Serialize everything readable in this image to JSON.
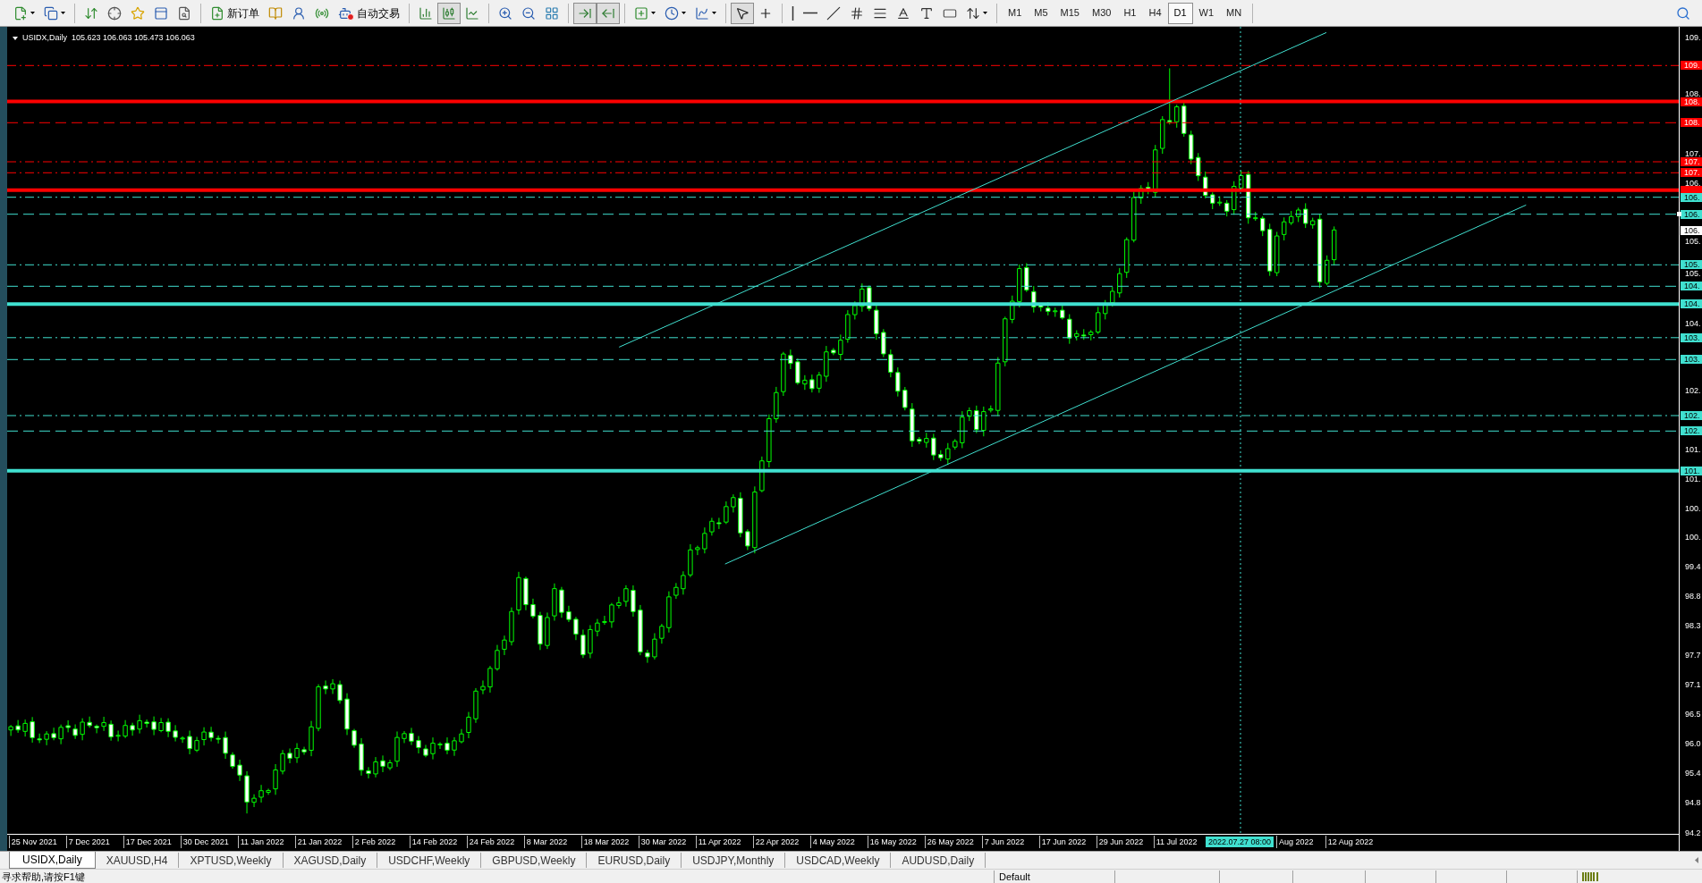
{
  "toolbar": {
    "order_button": "新订单",
    "autotrading": {
      "label": "自动交易",
      "enabled": false
    },
    "chart_types": [
      {
        "selected": false
      },
      {
        "selected": true
      },
      {
        "selected": false
      }
    ],
    "chart_toggles": [
      {
        "selected": true
      },
      {
        "selected": true
      }
    ],
    "cursor_tools": [
      {
        "selected": true
      },
      {
        "selected": false
      }
    ],
    "timeframes": [
      {
        "label": "M1",
        "selected": false
      },
      {
        "label": "M5",
        "selected": false
      },
      {
        "label": "M15",
        "selected": false
      },
      {
        "label": "M30",
        "selected": false
      },
      {
        "label": "H1",
        "selected": false
      },
      {
        "label": "H4",
        "selected": false
      },
      {
        "label": "D1",
        "selected": true
      },
      {
        "label": "W1",
        "selected": false
      },
      {
        "label": "MN",
        "selected": false
      }
    ]
  },
  "chart": {
    "symbol": "USIDX,Daily",
    "ohlc": "105.623 106.063 105.473 106.063",
    "price_ticks": [
      "109.",
      "108.",
      "107.",
      "106.",
      "105.",
      "105.",
      "104.",
      "102.",
      "101.",
      "101.",
      "100.",
      "100.",
      "99.4",
      "98.8",
      "98.3",
      "97.7",
      "97.1",
      "96.5",
      "96.0",
      "95.4",
      "94.8",
      "94.2"
    ],
    "current_price": "106.",
    "levels": [
      {
        "kind": "dashdot",
        "color": "#ff0000",
        "label": "109."
      },
      {
        "kind": "solid",
        "color": "#ff0000",
        "label": "108."
      },
      {
        "kind": "dash",
        "color": "#ff0000",
        "label": "108."
      },
      {
        "kind": "dashdot",
        "color": "#ff0000",
        "label": "107."
      },
      {
        "kind": "dashdot",
        "color": "#ff0000",
        "label": "107."
      },
      {
        "kind": "solid",
        "color": "#ff0000"
      },
      {
        "kind": "dashdot",
        "color": "#40e0d0",
        "label": "106."
      },
      {
        "kind": "dash",
        "color": "#40e0d0",
        "label": "106."
      },
      {
        "kind": "dashdot",
        "color": "#40e0d0",
        "label": "105."
      },
      {
        "kind": "dash",
        "color": "#40e0d0",
        "label": "104."
      },
      {
        "kind": "solid",
        "color": "#40e0d0",
        "label": "104."
      },
      {
        "kind": "dashdot",
        "color": "#40e0d0",
        "label": "103."
      },
      {
        "kind": "dash",
        "color": "#40e0d0",
        "label": "103."
      },
      {
        "kind": "dashdot",
        "color": "#40e0d0",
        "label": "102."
      },
      {
        "kind": "dash",
        "color": "#40e0d0",
        "label": "102."
      },
      {
        "kind": "solid",
        "color": "#40e0d0",
        "label": "101."
      }
    ],
    "time_labels": [
      "25 Nov 2021",
      "7 Dec 2021",
      "17 Dec 2021",
      "30 Dec 2021",
      "11 Jan 2022",
      "21 Jan 2022",
      "2 Feb 2022",
      "14 Feb 2022",
      "24 Feb 2022",
      "8 Mar 2022",
      "18 Mar 2022",
      "30 Mar 2022",
      "11 Apr 2022",
      "22 Apr 2022",
      "4 May 2022",
      "16 May 2022",
      "26 May 2022",
      "7 Jun 2022",
      "17 Jun 2022",
      "29 Jun 2022",
      "11 Jul 2022",
      "Aug 2022",
      "12 Aug 2022"
    ],
    "time_marker": "2022.07.27 08:00"
  },
  "tabs": [
    {
      "label": "USIDX,Daily",
      "selected": true
    },
    {
      "label": "XAUUSD,H4",
      "selected": false
    },
    {
      "label": "XPTUSD,Weekly",
      "selected": false
    },
    {
      "label": "XAGUSD,Daily",
      "selected": false
    },
    {
      "label": "USDCHF,Weekly",
      "selected": false
    },
    {
      "label": "GBPUSD,Weekly",
      "selected": false
    },
    {
      "label": "EURUSD,Daily",
      "selected": false
    },
    {
      "label": "USDJPY,Monthly",
      "selected": false
    },
    {
      "label": "USDCAD,Weekly",
      "selected": false
    },
    {
      "label": "AUDUSD,Daily",
      "selected": false
    }
  ],
  "status_bar": {
    "help": "寻求帮助,请按F1键",
    "profile": "Default"
  }
}
